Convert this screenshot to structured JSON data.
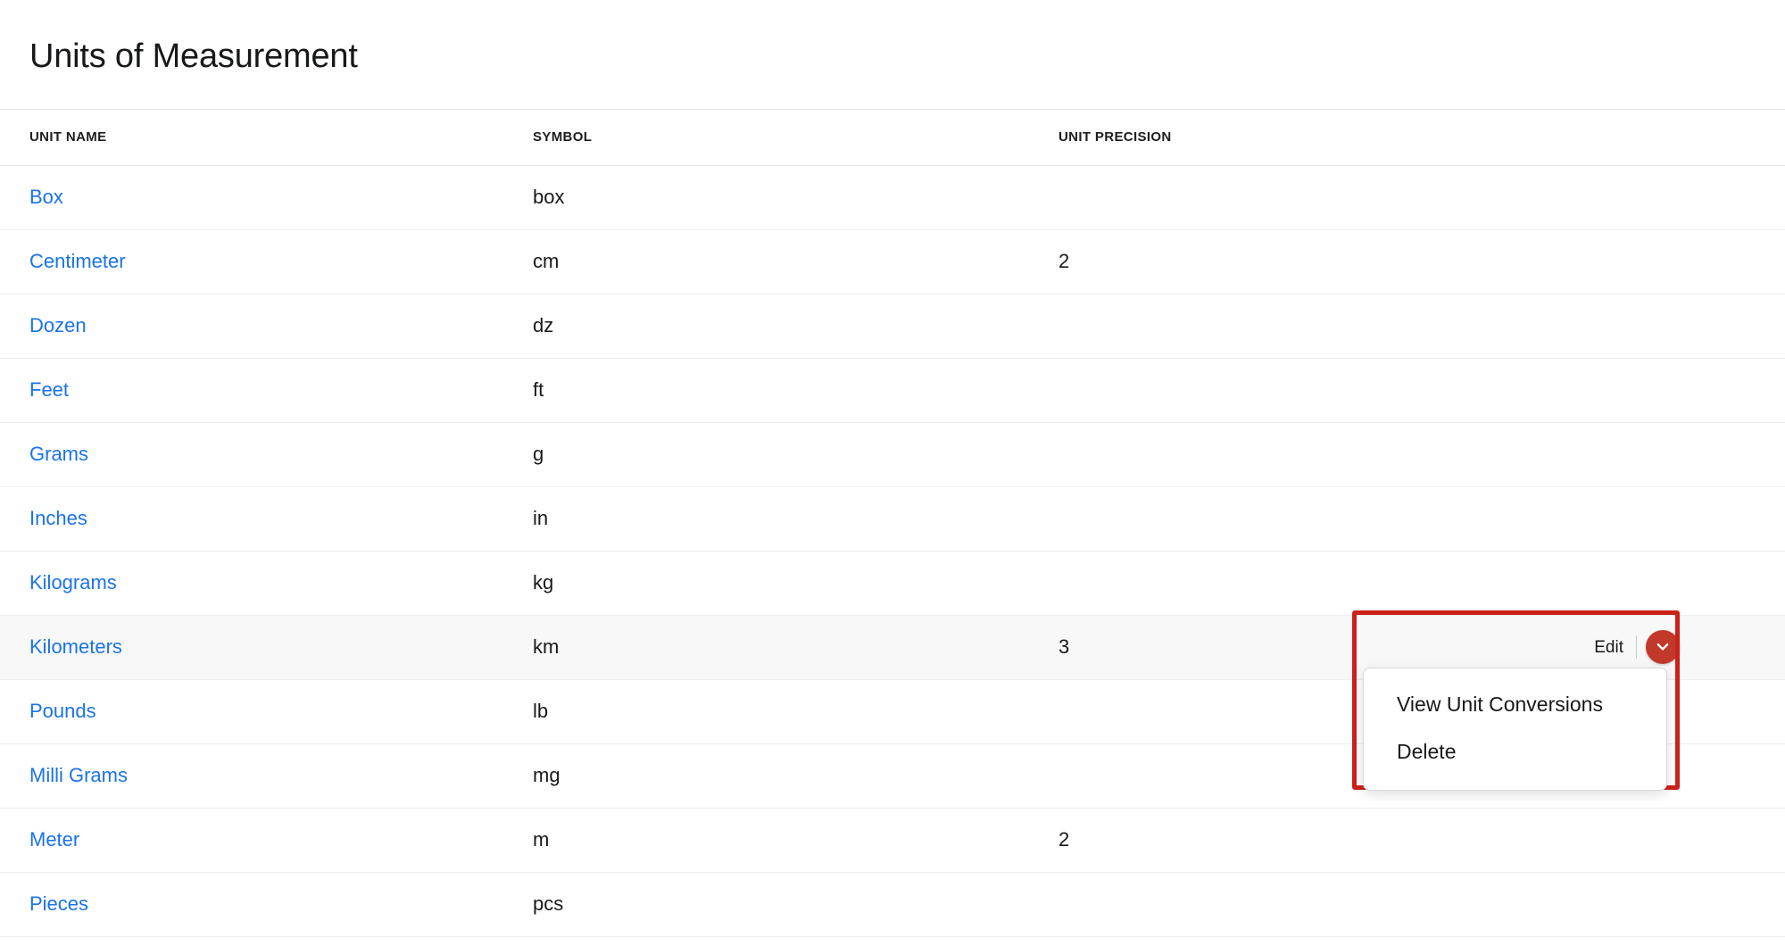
{
  "page": {
    "title": "Units of Measurement"
  },
  "table": {
    "columns": [
      {
        "key": "unit_name",
        "label": "UNIT NAME"
      },
      {
        "key": "symbol",
        "label": "SYMBOL"
      },
      {
        "key": "unit_precision",
        "label": "UNIT PRECISION"
      },
      {
        "key": "actions",
        "label": ""
      }
    ],
    "rows": [
      {
        "unit_name": "Box",
        "symbol": "box",
        "unit_precision": "",
        "active": false
      },
      {
        "unit_name": "Centimeter",
        "symbol": "cm",
        "unit_precision": "2",
        "active": false
      },
      {
        "unit_name": "Dozen",
        "symbol": "dz",
        "unit_precision": "",
        "active": false
      },
      {
        "unit_name": "Feet",
        "symbol": "ft",
        "unit_precision": "",
        "active": false
      },
      {
        "unit_name": "Grams",
        "symbol": "g",
        "unit_precision": "",
        "active": false
      },
      {
        "unit_name": "Inches",
        "symbol": "in",
        "unit_precision": "",
        "active": false
      },
      {
        "unit_name": "Kilograms",
        "symbol": "kg",
        "unit_precision": "",
        "active": false
      },
      {
        "unit_name": "Kilometers",
        "symbol": "km",
        "unit_precision": "3",
        "active": true
      },
      {
        "unit_name": "Pounds",
        "symbol": "lb",
        "unit_precision": "",
        "active": false
      },
      {
        "unit_name": "Milli Grams",
        "symbol": "mg",
        "unit_precision": "",
        "active": false
      },
      {
        "unit_name": "Meter",
        "symbol": "m",
        "unit_precision": "2",
        "active": false
      },
      {
        "unit_name": "Pieces",
        "symbol": "pcs",
        "unit_precision": "",
        "active": false
      }
    ]
  },
  "row_actions": {
    "edit_label": "Edit",
    "caret_icon": "chevron-down-icon",
    "caret_color": "#c0392b"
  },
  "dropdown": {
    "open": true,
    "items": [
      {
        "label": "View Unit Conversions"
      },
      {
        "label": "Delete"
      }
    ]
  },
  "annotation": {
    "highlight_color": "#cc2118"
  },
  "colors": {
    "link": "#1a73e8",
    "text": "#17181a",
    "row_border": "#ededed",
    "active_row_bg": "#f8f8f8"
  }
}
